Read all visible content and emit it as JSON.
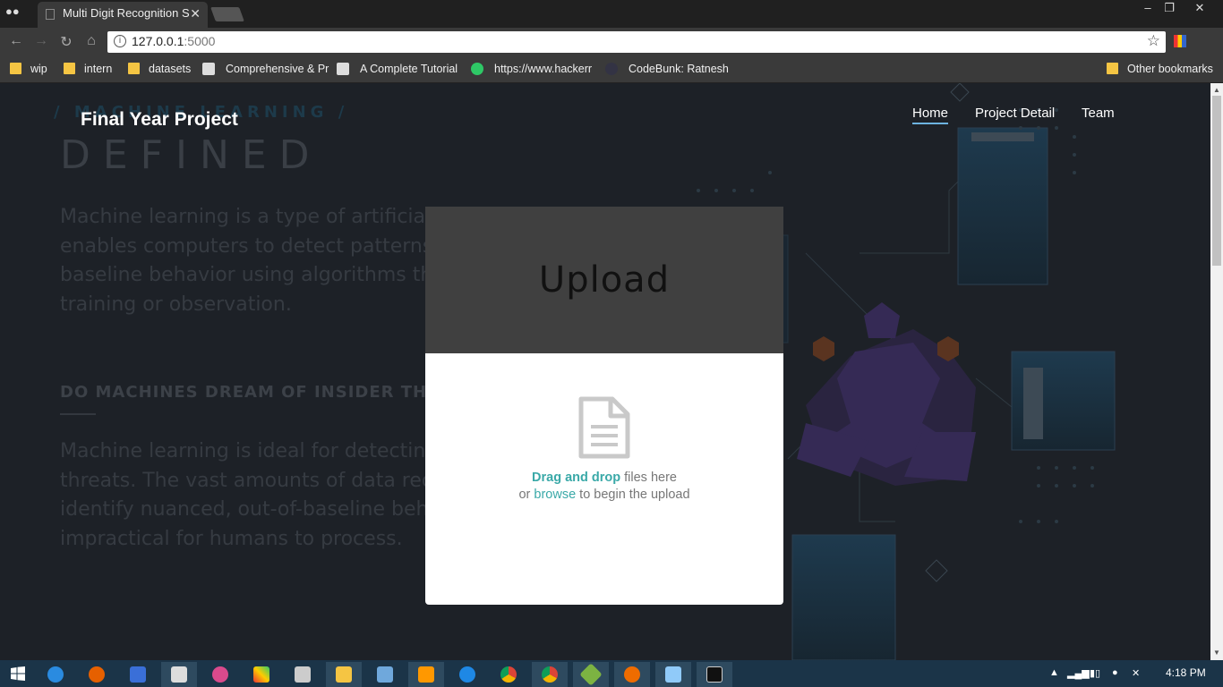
{
  "browser": {
    "tab_title": "Multi Digit Recognition S",
    "url_host": "127.0.0.1",
    "url_port": ":5000",
    "bookmarks": [
      {
        "label": "wip",
        "type": "folder"
      },
      {
        "label": "intern",
        "type": "folder"
      },
      {
        "label": "datasets",
        "type": "folder"
      },
      {
        "label": "Comprehensive & Pr",
        "type": "page"
      },
      {
        "label": "A Complete Tutorial",
        "type": "page"
      },
      {
        "label": "https://www.hackerr",
        "type": "page"
      },
      {
        "label": "CodeBunk: Ratnesh",
        "type": "page"
      }
    ],
    "other_bookmarks": "Other bookmarks"
  },
  "site": {
    "brand": "Final Year Project",
    "nav": [
      {
        "label": "Home",
        "active": true
      },
      {
        "label": "Project Detail",
        "active": false
      },
      {
        "label": "Team",
        "active": false
      }
    ],
    "background": {
      "eyebrow": "/ MACHINE LEARNING /",
      "heading": "DEFINED",
      "para1": [
        "Machine learning is a type of artificial i",
        "enables computers to detect patterns",
        "baseline behavior using algorithms tha",
        "training or observation."
      ],
      "subheading": "DO MACHINES DREAM OF INSIDER THR",
      "para2": [
        "Machine learning is ideal for detecting insid",
        "threats. The vast amounts of data required",
        "identify nuanced, out-of-baseline behavior a",
        "impractical for humans to process."
      ]
    }
  },
  "modal": {
    "title": "Upload",
    "drag_link": "Drag and drop",
    "drag_rest": " files here",
    "or_text": "or ",
    "browse_link": "browse",
    "browse_rest": " to begin the upload"
  },
  "taskbar": {
    "clock": "4:18 PM"
  },
  "colors": {
    "accent": "#3aa9a8",
    "nav_underline": "#6db3e0",
    "page_bg": "#1d2127"
  }
}
